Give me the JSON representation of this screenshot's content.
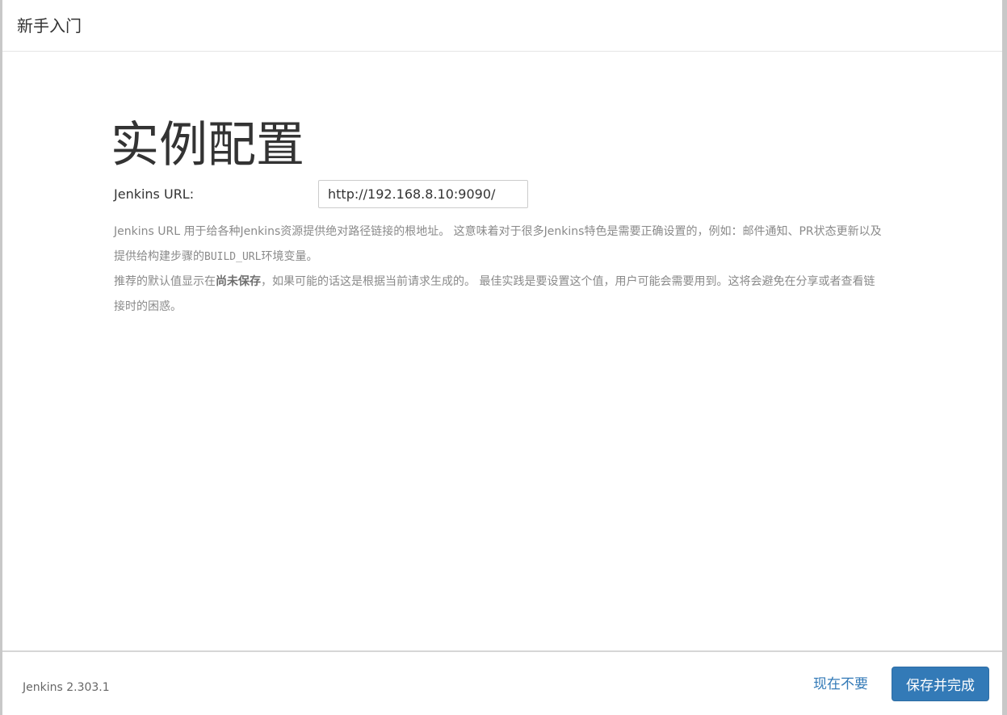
{
  "header": {
    "title": "新手入门"
  },
  "main": {
    "heading": "实例配置",
    "url_label": "Jenkins URL:",
    "url_value": "http://192.168.8.10:9090/",
    "help": {
      "p1_text_a": "Jenkins URL 用于给各种Jenkins资源提供绝对路径链接的根地址。 这意味着对于很多Jenkins特色是需要正确设置的，例如：邮件通知、PR状态更新以及提供给构建步骤的",
      "p1_code": "BUILD_URL",
      "p1_text_b": "环境变量。",
      "p2_text_a": "推荐的默认值显示在",
      "p2_strong": "尚未保存",
      "p2_text_b": "，如果可能的话这是根据当前请求生成的。 最佳实践是要设置这个值，用户可能会需要用到。这将会避免在分享或者查看链接时的困惑。"
    }
  },
  "footer": {
    "version": "Jenkins 2.303.1",
    "skip_label": "现在不要",
    "save_label": "保存并完成"
  },
  "colors": {
    "primary": "#337ab7",
    "text": "#333333",
    "muted": "#8a8a8a"
  }
}
